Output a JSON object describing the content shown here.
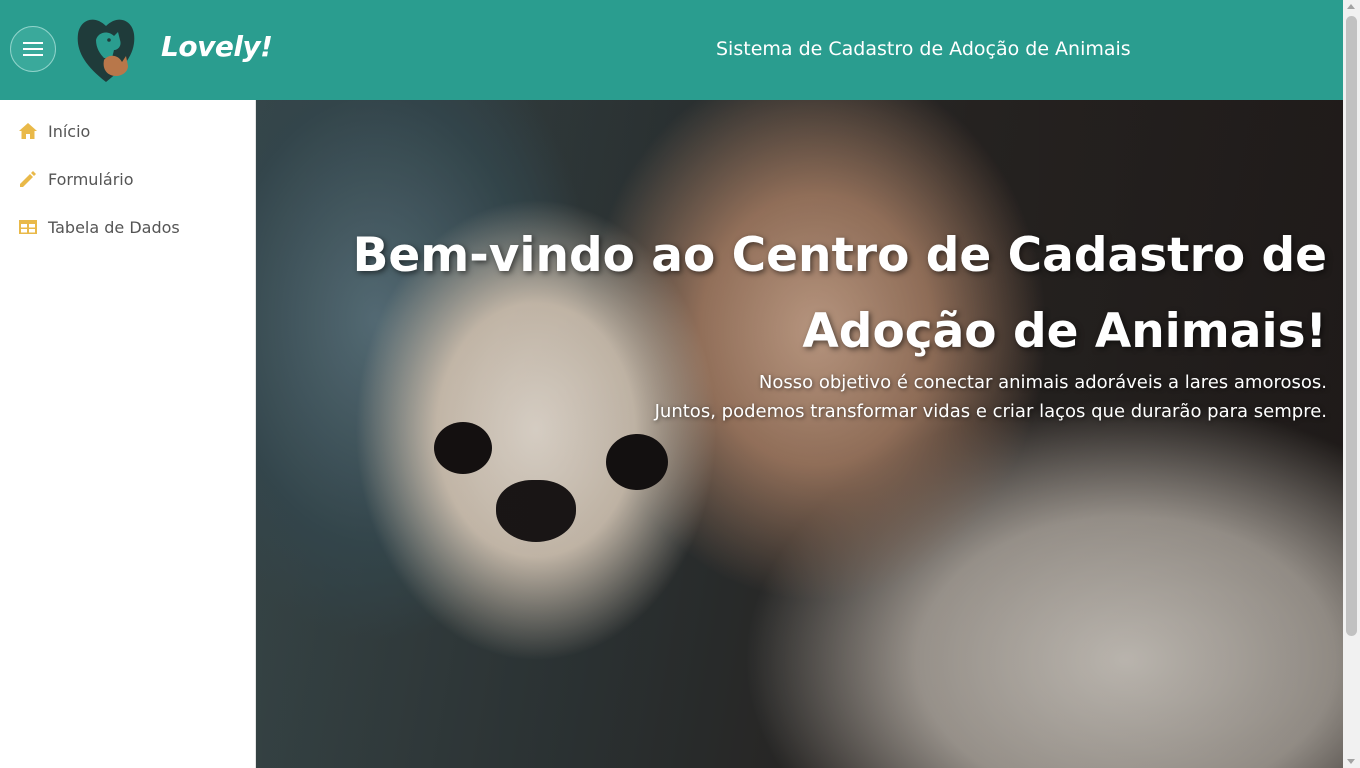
{
  "header": {
    "brand": "Lovely!",
    "title": "Sistema de Cadastro de Adoção de Animais",
    "menu_icon": "hamburger-icon",
    "logo_icon": "pet-heart-logo"
  },
  "sidebar": {
    "items": [
      {
        "label": "Início",
        "icon": "home-icon"
      },
      {
        "label": "Formulário",
        "icon": "pencil-icon"
      },
      {
        "label": "Tabela de Dados",
        "icon": "table-icon"
      }
    ]
  },
  "hero": {
    "title_line1": "Bem-vindo ao Centro de Cadastro de",
    "title_line2": "Adoção de Animais!",
    "subtitle_line1": "Nosso objetivo é conectar animais adoráveis a lares amorosos.",
    "subtitle_line2": "Juntos, podemos transformar vidas e criar laços que durarão para sempre."
  },
  "colors": {
    "header_bg": "#2a9d8f",
    "icon_accent": "#e9b949",
    "text_muted": "#555555"
  }
}
